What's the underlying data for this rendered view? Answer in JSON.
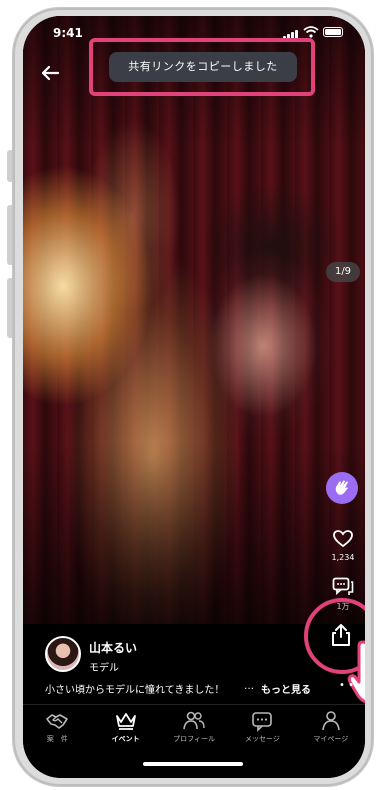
{
  "status_bar": {
    "time": "9:41"
  },
  "toast": {
    "text": "共有リンクをコピーしました"
  },
  "gallery": {
    "page_indicator": "1/9"
  },
  "actions": {
    "like_count": "1,234",
    "comment_count": "1万"
  },
  "post": {
    "username": "山本るい",
    "role": "モデル",
    "caption": "小さい頃からモデルに憧れてきました！",
    "caption_ellipsis": "…",
    "more_label": "もっと見る",
    "dots": "• •"
  },
  "nav": {
    "items": [
      {
        "label": "案　件",
        "icon": "handshake-icon"
      },
      {
        "label": "イベント",
        "icon": "crown-icon",
        "active": true
      },
      {
        "label": "プロフィール",
        "icon": "people-icon"
      },
      {
        "label": "メッセージ",
        "icon": "message-icon"
      },
      {
        "label": "マイページ",
        "icon": "person-icon"
      }
    ]
  },
  "colors": {
    "highlight": "#e2427a",
    "applause": "#9b6df2",
    "toast_bg": "#3b3e46"
  }
}
